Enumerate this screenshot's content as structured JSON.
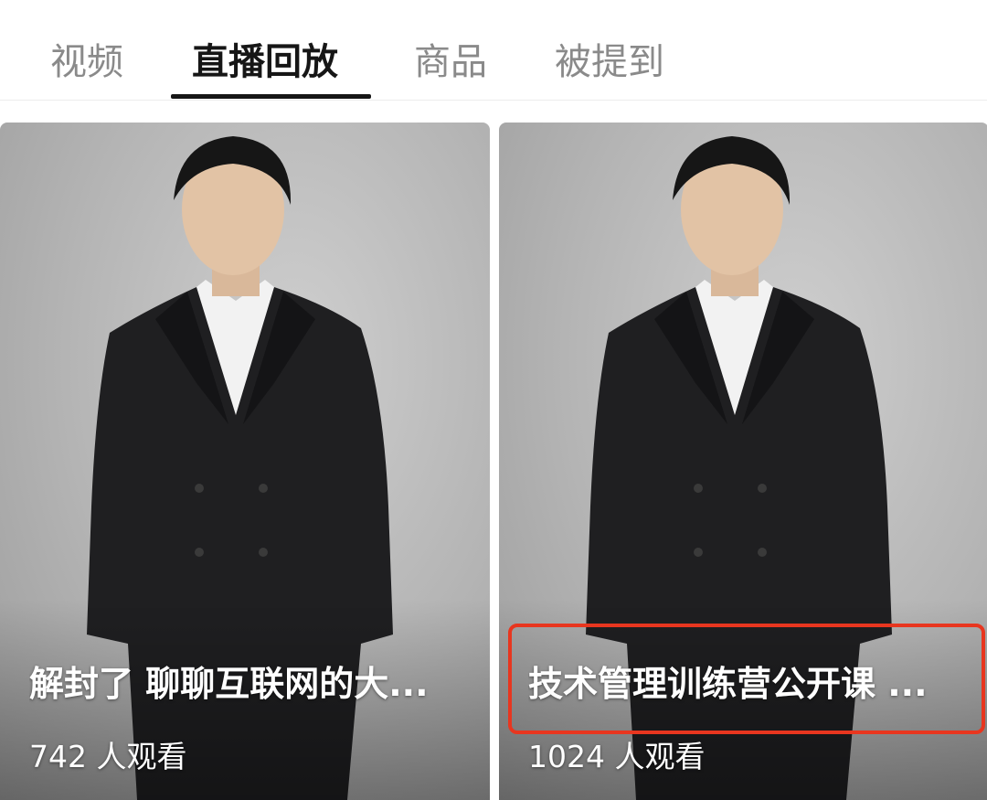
{
  "tabs": [
    {
      "label": "视频",
      "active": false
    },
    {
      "label": "直播回放",
      "active": true
    },
    {
      "label": "商品",
      "active": false
    },
    {
      "label": "被提到",
      "active": false
    }
  ],
  "cards": [
    {
      "title": "解封了 聊聊互联网的大...",
      "views": "742 人观看",
      "image": "man-in-suit-portrait"
    },
    {
      "title": "技术管理训练营公开课 ...",
      "views": "1024 人观看",
      "image": "man-in-suit-portrait"
    }
  ],
  "colors": {
    "active_tab": "#161616",
    "inactive_tab": "#8a8a8a",
    "highlight": "#e8361f"
  }
}
